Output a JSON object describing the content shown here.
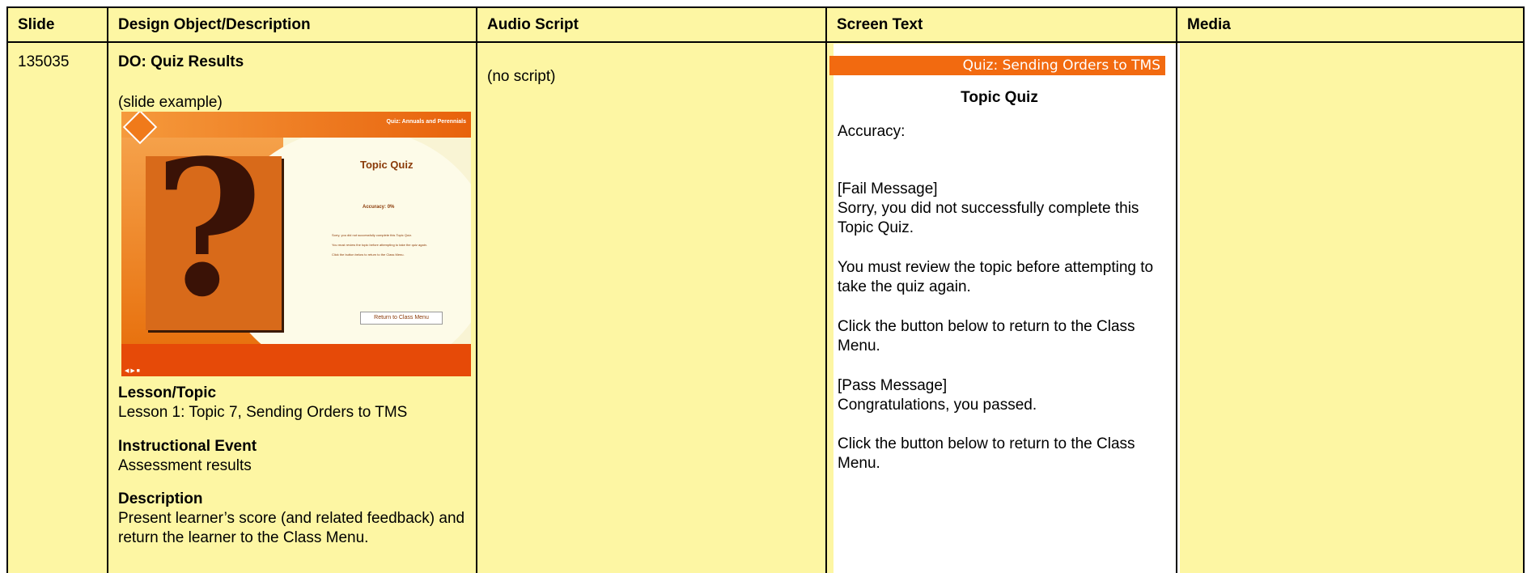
{
  "headers": {
    "slide": "Slide",
    "design": "Design Object/Description",
    "audio": "Audio Script",
    "screen": "Screen Text",
    "media": "Media"
  },
  "row": {
    "slide_id": "135035",
    "design_title": "DO: Quiz Results",
    "slide_example": "(slide example)",
    "lesson_label": "Lesson/Topic",
    "lesson_value": "Lesson 1: Topic 7, Sending Orders to TMS",
    "event_label": "Instructional Event",
    "event_value": "Assessment results",
    "desc_label": "Description",
    "desc_value": "Present learner’s score (and related feedback) and return the learner to the Class Menu.",
    "audio_script": "(no script)",
    "screen_bar": "Quiz: Sending Orders to TMS",
    "screen_title": "Topic Quiz",
    "screen_accuracy": "Accuracy:",
    "fail_label": "[Fail Message]",
    "fail_msg": "Sorry, you did not successfully complete this Topic Quiz.",
    "review_msg": "You must review the topic before attempting to take the quiz again.",
    "click_msg1": "Click the button below to return to the Class Menu.",
    "pass_label": "[Pass Message]",
    "pass_msg": "Congratulations, you passed.",
    "click_msg2": "Click the button below to return to the Class Menu."
  },
  "thumbnail": {
    "header": "Quiz: Annuals and Perennials",
    "title": "Topic Quiz",
    "accuracy": "Accuracy:",
    "accuracy_value": "0%",
    "line1": "Sorry, you did not successfully complete this Topic Quiz.",
    "line2": "You must review the topic before attempting to take the quiz again.",
    "line3": "Click the button below to return to the Class Menu.",
    "button": "Return to Class Menu",
    "nav": "◀ ▶ ■"
  }
}
